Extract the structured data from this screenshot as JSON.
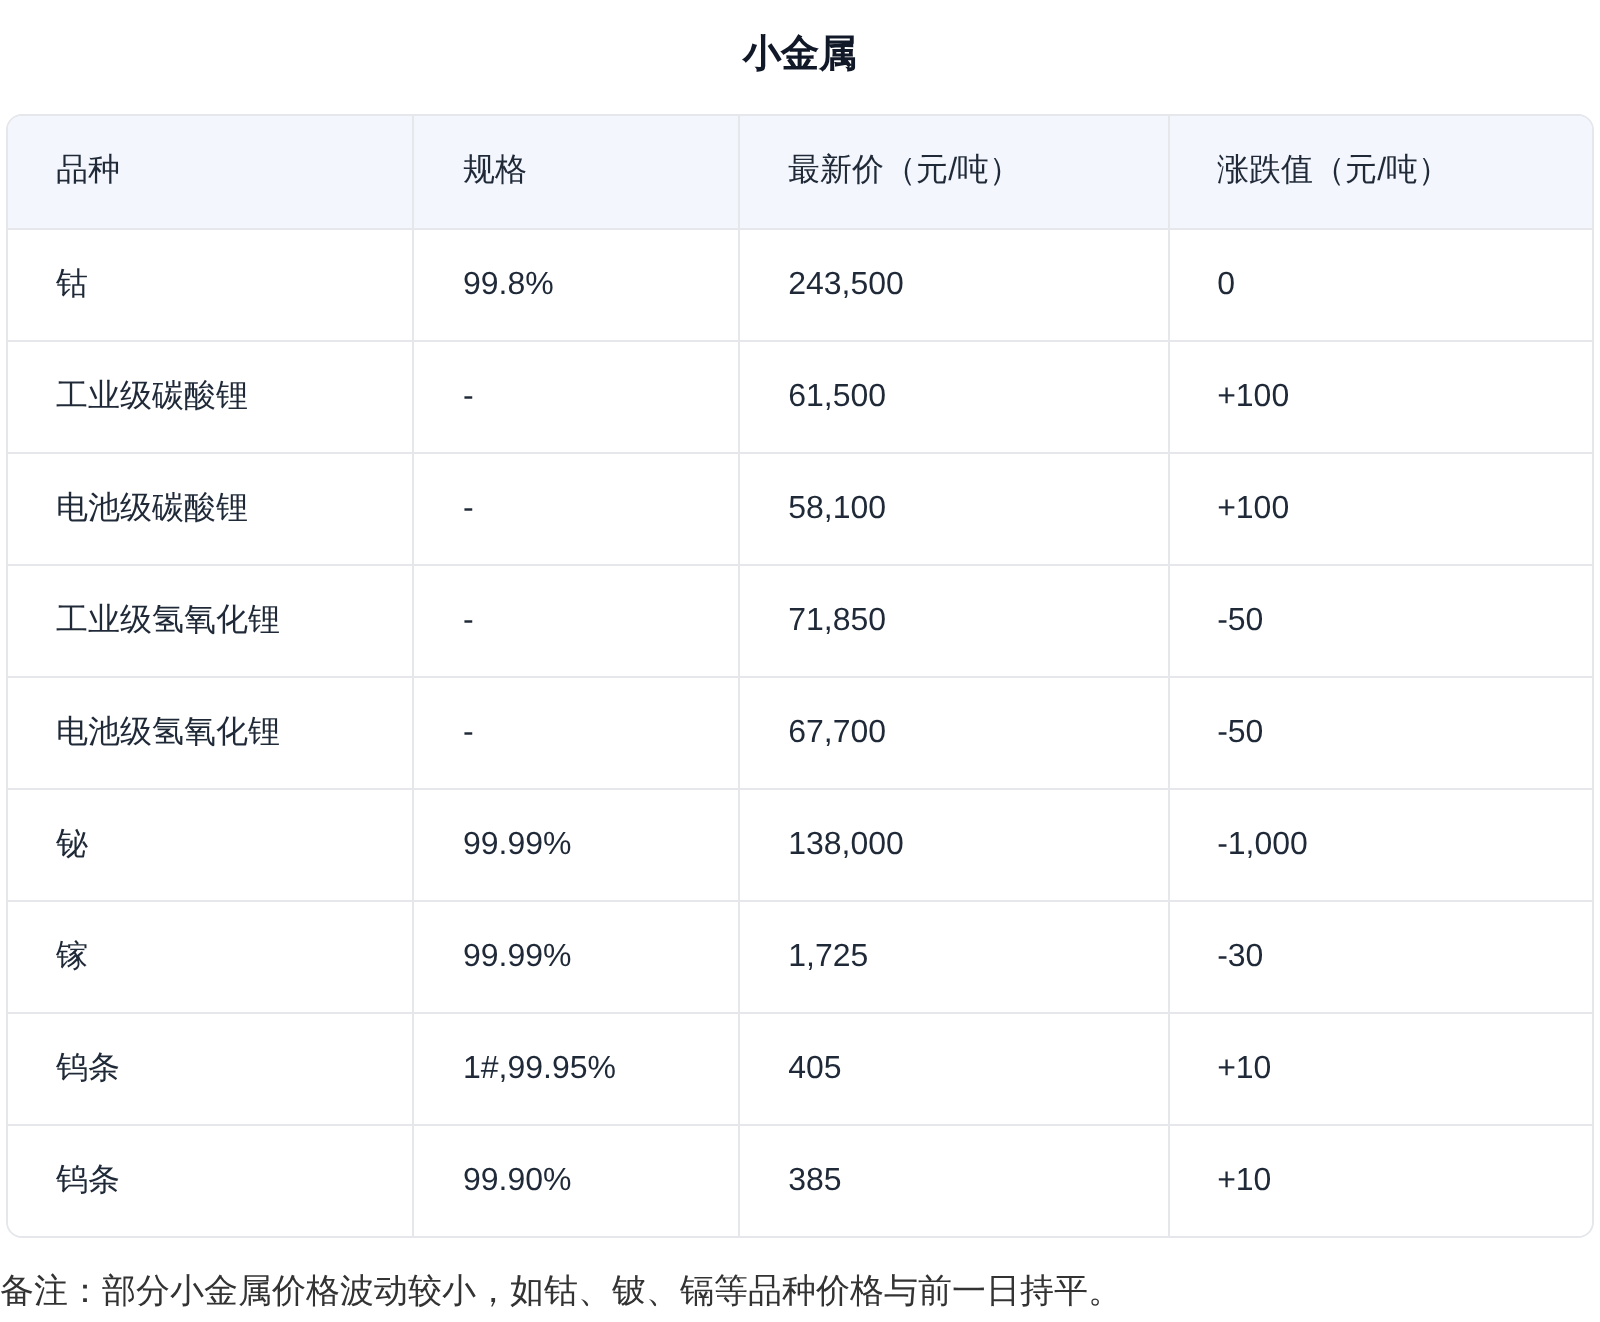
{
  "title": "小金属",
  "table": {
    "columns": [
      "品种",
      "规格",
      "最新价（元/吨）",
      "涨跌值（元/吨）"
    ],
    "rows": [
      [
        "钴",
        "99.8%",
        "243,500",
        "0"
      ],
      [
        "工业级碳酸锂",
        "-",
        "61,500",
        "+100"
      ],
      [
        "电池级碳酸锂",
        "-",
        "58,100",
        "+100"
      ],
      [
        "工业级氢氧化锂",
        "-",
        "71,850",
        "-50"
      ],
      [
        "电池级氢氧化锂",
        "-",
        "67,700",
        "-50"
      ],
      [
        "铋",
        "99.99%",
        "138,000",
        "-1,000"
      ],
      [
        "镓",
        "99.99%",
        "1,725",
        "-30"
      ],
      [
        "钨条",
        "1#,99.95%",
        "405",
        "+10"
      ],
      [
        "钨条",
        "99.90%",
        "385",
        "+10"
      ]
    ]
  },
  "note": "备注：部分小金属价格波动较小，如钴、铍、镉等品种价格与前一日持平。"
}
